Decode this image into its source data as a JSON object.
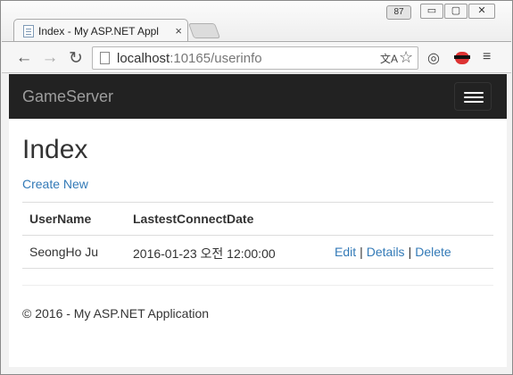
{
  "browser": {
    "tab_title": "Index - My ASP.NET Appl",
    "tab_close": "×",
    "window_badge": "87",
    "window_min": "▭",
    "window_max": "▢",
    "window_close": "✕",
    "url_host": "localhost",
    "url_path": ":10165/userinfo",
    "icons": {
      "back": "←",
      "forward": "→",
      "reload": "↻",
      "translate": "文A",
      "star": "☆",
      "globe": "◎",
      "menu": "≡"
    }
  },
  "navbar": {
    "brand": "GameServer"
  },
  "page": {
    "title": "Index",
    "create_link": "Create New",
    "table": {
      "columns": [
        "UserName",
        "LastestConnectDate"
      ],
      "rows": [
        {
          "username": "SeongHo Ju",
          "date": "2016-01-23 오전 12:00:00",
          "actions": [
            "Edit",
            "Details",
            "Delete"
          ],
          "separator": "|"
        }
      ]
    },
    "footer": "© 2016 - My ASP.NET Application"
  },
  "colors": {
    "link": "#337ab7",
    "navbar_bg": "#222222",
    "brand_text": "#9d9d9d"
  }
}
